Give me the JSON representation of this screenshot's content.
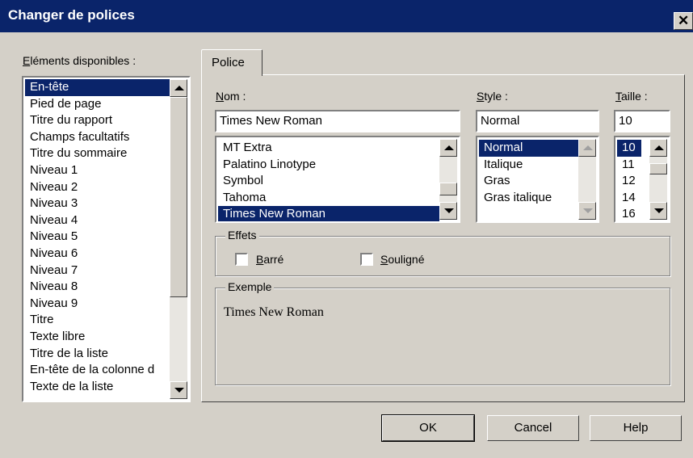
{
  "window": {
    "title": "Changer de polices",
    "close_glyph": "✕"
  },
  "available": {
    "label_accel": "E",
    "label_rest": "léments disponibles :",
    "items": [
      "En-tête",
      "Pied de page",
      "Titre du rapport",
      "Champs facultatifs",
      "Titre du sommaire",
      "Niveau 1",
      "Niveau 2",
      "Niveau 3",
      "Niveau 4",
      "Niveau 5",
      "Niveau 6",
      "Niveau 7",
      "Niveau 8",
      "Niveau 9",
      "Titre",
      "Texte libre",
      "Titre de la liste",
      "En-tête de la colonne d",
      "Texte de la liste"
    ],
    "selected": "En-tête"
  },
  "tab": {
    "label": "Police"
  },
  "font": {
    "name_accel": "N",
    "name_rest": "om :",
    "name_value": "Times New Roman",
    "names": [
      "MT Extra",
      "Palatino Linotype",
      "Symbol",
      "Tahoma",
      "Times New Roman"
    ],
    "selected_name": "Times New Roman",
    "style_accel": "S",
    "style_rest": "tyle :",
    "style_value": "Normal",
    "styles": [
      "Normal",
      "Italique",
      "Gras",
      "Gras italique"
    ],
    "selected_style": "Normal",
    "size_accel": "T",
    "size_rest": "aille :",
    "size_value": "10",
    "sizes": [
      "10",
      "11",
      "12",
      "14",
      "16"
    ],
    "selected_size": "10"
  },
  "effects": {
    "label": "Effets",
    "strike_accel": "B",
    "strike_rest": "arré",
    "strike_checked": false,
    "underline_accel": "S",
    "underline_rest": "ouligné",
    "underline_checked": false
  },
  "sample": {
    "label": "Exemple",
    "text": "Times New Roman"
  },
  "buttons": {
    "ok": "OK",
    "cancel": "Cancel",
    "help": "Help"
  }
}
